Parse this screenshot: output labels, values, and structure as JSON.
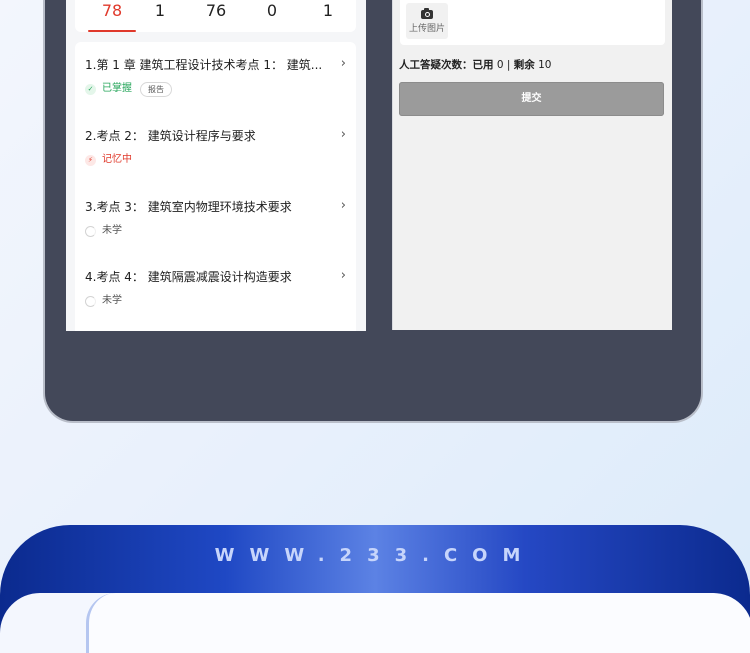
{
  "stats": [
    "78",
    "1",
    "76",
    "0",
    "1"
  ],
  "items": [
    {
      "title": "1.第 1 章 建筑工程设计技术考点 1： 建筑...",
      "status": "已掌握",
      "status_type": "ok",
      "badge": "报告"
    },
    {
      "title": "2.考点 2： 建筑设计程序与要求",
      "status": "记忆中",
      "status_type": "mem"
    },
    {
      "title": "3.考点 3： 建筑室内物理环境技术要求",
      "status": "未学",
      "status_type": "none"
    },
    {
      "title": "4.考点 4： 建筑隔震减震设计构造要求",
      "status": "未学",
      "status_type": "none"
    }
  ],
  "upload": {
    "label": "上传图片"
  },
  "quota": {
    "label": "人工答疑次数：",
    "used_label": "已用",
    "used": "0",
    "sep": "|",
    "remain_label": "剩余",
    "remain": "10"
  },
  "submit_label": "提交",
  "banner": {
    "url_text": "WWW.233.COM"
  },
  "icons": {
    "chevron": "chevron-right-icon",
    "camera": "camera-icon",
    "check": "check-icon",
    "bolt": "bolt-icon",
    "loading": "loading-ring-icon"
  },
  "colors": {
    "accent": "#e0392b",
    "success": "#25a55a",
    "frame": "#434859",
    "banner": "#1f48c4"
  }
}
